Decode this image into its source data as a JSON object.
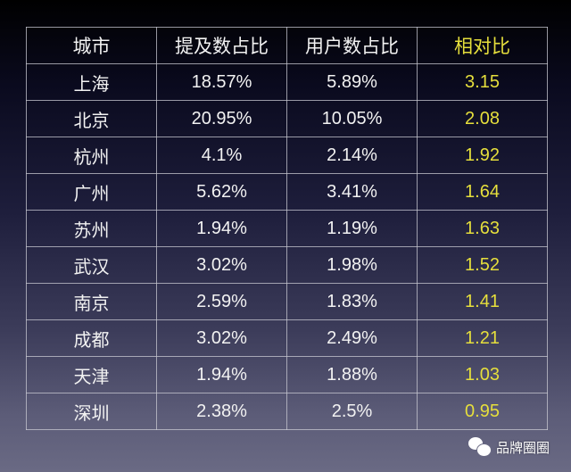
{
  "table": {
    "headers": [
      "城市",
      "提及数占比",
      "用户数占比",
      "相对比"
    ],
    "rows": [
      {
        "city": "上海",
        "mention_share": "18.57%",
        "user_share": "5.89%",
        "ratio": "3.15"
      },
      {
        "city": "北京",
        "mention_share": "20.95%",
        "user_share": "10.05%",
        "ratio": "2.08"
      },
      {
        "city": "杭州",
        "mention_share": "4.1%",
        "user_share": "2.14%",
        "ratio": "1.92"
      },
      {
        "city": "广州",
        "mention_share": "5.62%",
        "user_share": "3.41%",
        "ratio": "1.64"
      },
      {
        "city": "苏州",
        "mention_share": "1.94%",
        "user_share": "1.19%",
        "ratio": "1.63"
      },
      {
        "city": "武汉",
        "mention_share": "3.02%",
        "user_share": "1.98%",
        "ratio": "1.52"
      },
      {
        "city": "南京",
        "mention_share": "2.59%",
        "user_share": "1.83%",
        "ratio": "1.41"
      },
      {
        "city": "成都",
        "mention_share": "3.02%",
        "user_share": "2.49%",
        "ratio": "1.21"
      },
      {
        "city": "天津",
        "mention_share": "1.94%",
        "user_share": "1.88%",
        "ratio": "1.03"
      },
      {
        "city": "深圳",
        "mention_share": "2.38%",
        "user_share": "2.5%",
        "ratio": "0.95"
      }
    ]
  },
  "watermark": {
    "icon": "wechat-icon",
    "text": "品牌圈圈"
  },
  "colors": {
    "text": "#f2f2f2",
    "ratio_highlight": "#e6df3c",
    "grid": "#c8c8d2"
  }
}
